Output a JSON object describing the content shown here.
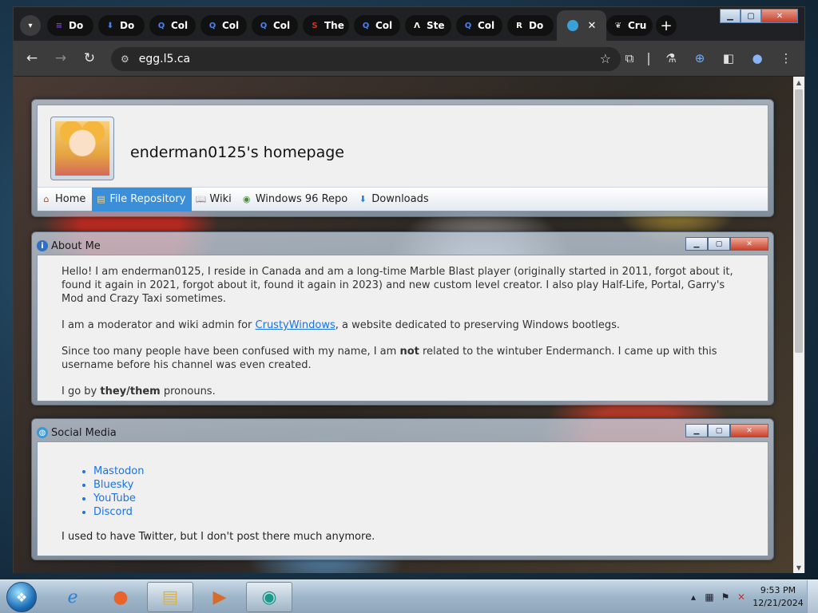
{
  "browser": {
    "tabs": [
      {
        "label": "Do",
        "icon": "stack-icon",
        "color": "#7b3fe4"
      },
      {
        "label": "Do",
        "icon": "download-icon",
        "color": "#4285f4"
      },
      {
        "label": "Col",
        "icon": "search-icon",
        "color": "#4285f4"
      },
      {
        "label": "Col",
        "icon": "search-icon",
        "color": "#4285f4"
      },
      {
        "label": "Col",
        "icon": "search-icon",
        "color": "#4285f4"
      },
      {
        "label": "The",
        "icon": "s-logo-icon",
        "color": "#d93025"
      },
      {
        "label": "Col",
        "icon": "search-icon",
        "color": "#4285f4"
      },
      {
        "label": "Ste",
        "icon": "a-logo-icon",
        "color": "#ffffff"
      },
      {
        "label": "Col",
        "icon": "search-icon",
        "color": "#4285f4"
      },
      {
        "label": "Do",
        "icon": "r-logo-icon",
        "color": "#ffffff"
      }
    ],
    "active_tab": {
      "icon": "globe-icon",
      "close": "✕"
    },
    "last_tab": {
      "label": "Cru",
      "icon": "feather-icon"
    },
    "url": "egg.l5.ca"
  },
  "page": {
    "site_title": "enderman0125's homepage",
    "nav": [
      {
        "label": "Home",
        "icon": "house-icon"
      },
      {
        "label": "File Repository",
        "icon": "folder-icon",
        "active": true
      },
      {
        "label": "Wiki",
        "icon": "book-icon"
      },
      {
        "label": "Windows 96 Repo",
        "icon": "disc-icon"
      },
      {
        "label": "Downloads",
        "icon": "download-arrow-icon"
      }
    ],
    "about": {
      "title": "About Me",
      "p1": "Hello! I am enderman0125, I reside in Canada and am a long-time Marble Blast player (originally started in 2011, forgot about it, found it again in 2021, forgot about it, found it again in 2023) and new custom level creator. I also play Half-Life, Portal, Garry's Mod and Crazy Taxi sometimes.",
      "p2_before": "I am a moderator and wiki admin for ",
      "p2_link": "CrustyWindows",
      "p2_after": ", a website dedicated to preserving Windows bootlegs.",
      "p3_before": "Since too many people have been confused with my name, I am ",
      "p3_bold": "not",
      "p3_after": " related to the wintuber Endermanch. I came up with this username before his channel was even created.",
      "p4_before": "I go by ",
      "p4_bold": "they/them",
      "p4_after": " pronouns."
    },
    "social": {
      "title": "Social Media",
      "links": [
        "Mastodon",
        "Bluesky",
        "YouTube",
        "Discord"
      ],
      "note": "I used to have Twitter, but I don't post there much anymore."
    }
  },
  "taskbar": {
    "time": "9:53 PM",
    "date": "12/21/2024"
  }
}
